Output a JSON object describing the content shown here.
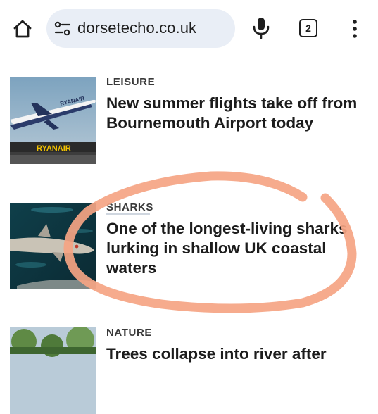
{
  "browser": {
    "url": "dorsetecho.co.uk",
    "tab_count": "2",
    "icons": [
      "home-icon",
      "site-settings-icon",
      "mic-icon",
      "tabs-icon",
      "more-vert-icon"
    ]
  },
  "articles": [
    {
      "category": "LEISURE",
      "headline": "New summer flights take off from Bournemouth Airport today",
      "image_text": "RYANAIR"
    },
    {
      "category": "SHARKS",
      "headline": "One of the longest-living sharks lurking in shallow UK coastal waters"
    },
    {
      "category": "NATURE",
      "headline": "Trees collapse into river after"
    }
  ],
  "colors": {
    "url_bar_bg": "#e9eef6",
    "annotation_stroke": "#f5a483",
    "text": "#1c1c1c"
  }
}
